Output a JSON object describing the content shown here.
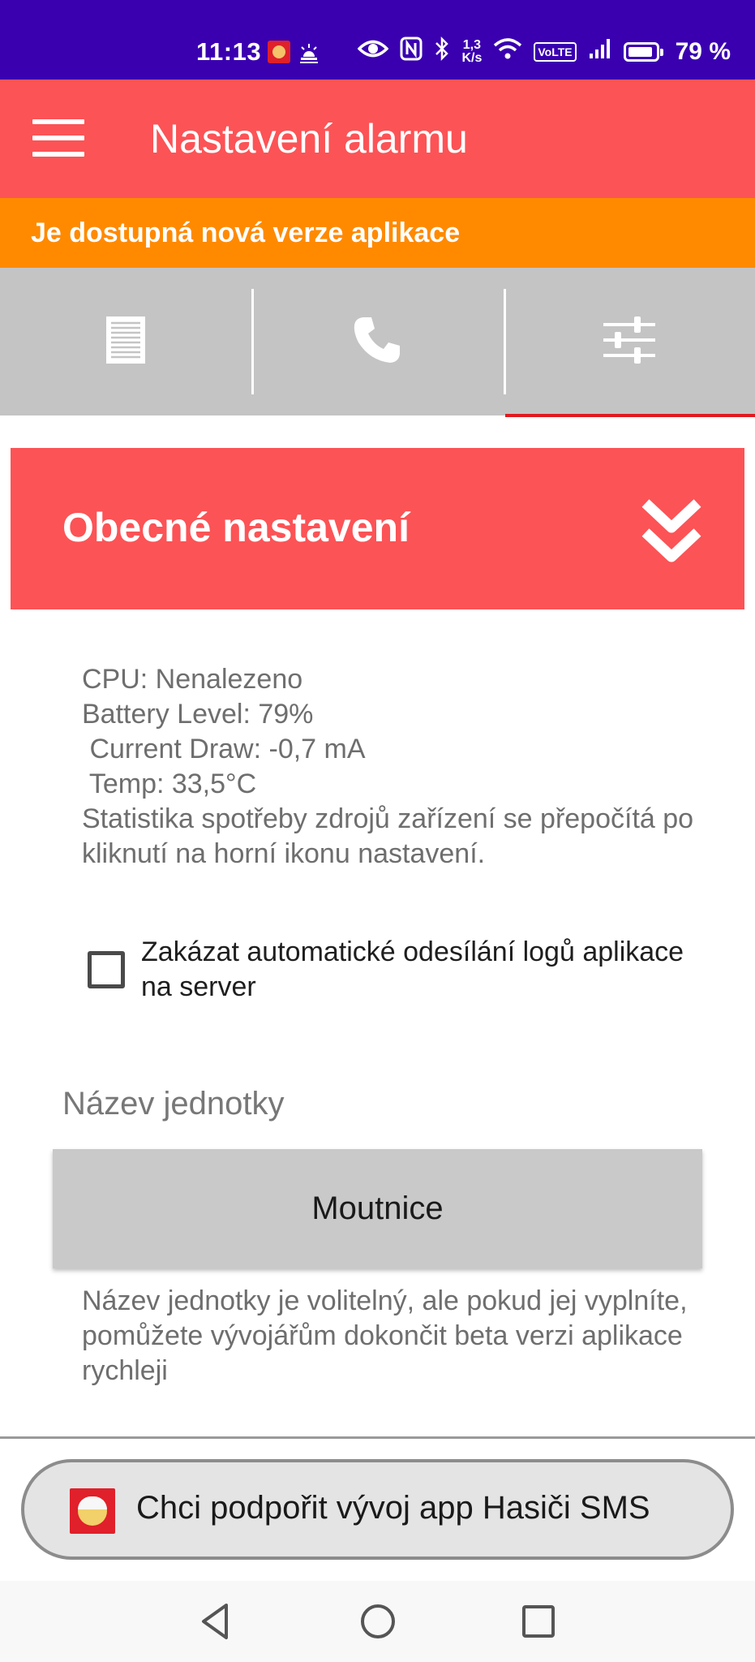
{
  "status_bar": {
    "time": "11:13",
    "net_speed_value": "1,3",
    "net_speed_unit": "K/s",
    "volte": "VoLTE",
    "battery_percent": "79 %",
    "icons": [
      "app-notification-icon",
      "alarm-light-icon",
      "eye-icon",
      "nfc-icon",
      "bluetooth-icon",
      "wifi-icon",
      "signal-icon",
      "battery-icon"
    ]
  },
  "app_bar": {
    "title": "Nastavení alarmu"
  },
  "update_banner": {
    "text": "Je dostupná nová verze aplikace"
  },
  "tabs": [
    {
      "icon": "document-icon",
      "active": false
    },
    {
      "icon": "phone-icon",
      "active": false
    },
    {
      "icon": "sliders-icon",
      "active": true
    }
  ],
  "section": {
    "title": "Obecné nastavení",
    "toggle_icon": "double-chevron-down-icon"
  },
  "device_info": {
    "cpu": "CPU: Nenalezeno",
    "battery_level": "Battery Level: 79%",
    "current_draw": " Current Draw: -0,7 mA",
    "temp": " Temp: 33,5°C",
    "note": "Statistika spotřeby zdrojů zařízení se přepočítá po kliknutí na horní ikonu nastavení."
  },
  "logs_checkbox": {
    "label": "Zakázat automatické odesílání logů aplikace na server",
    "checked": false
  },
  "unit_name": {
    "label": "Název jednotky",
    "value": "Moutnice",
    "help": "Název jednotky je volitelný, ale pokud jej vyplníte, pomůžete vývojářům dokončit beta verzi aplikace rychleji"
  },
  "support_button": {
    "label": "Chci podpořit vývoj app Hasiči SMS"
  },
  "colors": {
    "status_bar": "#3a00b0",
    "primary": "#fc5356",
    "banner": "#ff8a00",
    "tabs_bg": "#c4c4c4",
    "active_indicator": "#e01a20"
  }
}
